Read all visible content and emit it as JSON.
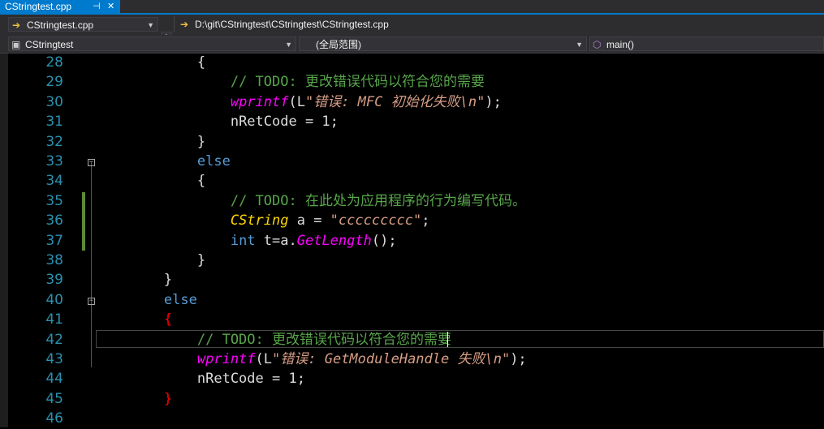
{
  "tab": {
    "title": "CStringtest.cpp",
    "pin_icon": "pin-icon",
    "close_icon": "close-icon"
  },
  "toolbar": {
    "file_combo": "CStringtest.cpp",
    "path": "D:\\git\\CStringtest\\CStringtest\\CStringtest.cpp",
    "project_combo": "CStringtest",
    "scope_combo": "(全局范围)",
    "member_combo": "main()"
  },
  "editor": {
    "lines": [
      {
        "num": "28",
        "indent": "            ",
        "tokens": [
          {
            "t": "{",
            "c": ""
          }
        ]
      },
      {
        "num": "29",
        "indent": "                ",
        "tokens": [
          {
            "t": "// TODO: 更改错误代码以符合您的需要",
            "c": "cmt"
          }
        ]
      },
      {
        "num": "30",
        "indent": "                ",
        "tokens": [
          {
            "t": "wprintf",
            "c": "fn"
          },
          {
            "t": "(L",
            "c": ""
          },
          {
            "t": "\"错误: MFC 初始化失败\\n\"",
            "c": "str"
          },
          {
            "t": ");",
            "c": ""
          }
        ]
      },
      {
        "num": "31",
        "indent": "                ",
        "tokens": [
          {
            "t": "nRetCode = 1;",
            "c": ""
          }
        ]
      },
      {
        "num": "32",
        "indent": "            ",
        "tokens": [
          {
            "t": "}",
            "c": ""
          }
        ]
      },
      {
        "num": "33",
        "indent": "            ",
        "tokens": [
          {
            "t": "else",
            "c": "kw"
          }
        ]
      },
      {
        "num": "34",
        "indent": "            ",
        "tokens": [
          {
            "t": "{",
            "c": ""
          }
        ]
      },
      {
        "num": "35",
        "indent": "                ",
        "tokens": [
          {
            "t": "// TODO: 在此处为应用程序的行为编写代码。",
            "c": "cmt"
          }
        ]
      },
      {
        "num": "36",
        "indent": "                ",
        "tokens": [
          {
            "t": "CString",
            "c": "ty"
          },
          {
            "t": " a = ",
            "c": ""
          },
          {
            "t": "\"ccccccccc\"",
            "c": "str"
          },
          {
            "t": ";",
            "c": ""
          }
        ]
      },
      {
        "num": "37",
        "indent": "                ",
        "tokens": [
          {
            "t": "int",
            "c": "kw"
          },
          {
            "t": " t=a.",
            "c": ""
          },
          {
            "t": "GetLength",
            "c": "fn"
          },
          {
            "t": "();",
            "c": ""
          }
        ]
      },
      {
        "num": "38",
        "indent": "            ",
        "tokens": [
          {
            "t": "}",
            "c": ""
          }
        ]
      },
      {
        "num": "39",
        "indent": "        ",
        "tokens": [
          {
            "t": "}",
            "c": ""
          }
        ]
      },
      {
        "num": "40",
        "indent": "        ",
        "tokens": [
          {
            "t": "else",
            "c": "kw"
          }
        ]
      },
      {
        "num": "41",
        "indent": "        ",
        "tokens": [
          {
            "t": "{",
            "c": "brace-red"
          }
        ]
      },
      {
        "num": "42",
        "indent": "            ",
        "tokens": [
          {
            "t": "// TODO: 更改错误代码以符合您的需要",
            "c": "cmt"
          }
        ]
      },
      {
        "num": "43",
        "indent": "            ",
        "tokens": [
          {
            "t": "wprintf",
            "c": "fn"
          },
          {
            "t": "(L",
            "c": ""
          },
          {
            "t": "\"错误: GetModuleHandle 失败\\n\"",
            "c": "str"
          },
          {
            "t": ");",
            "c": ""
          }
        ]
      },
      {
        "num": "44",
        "indent": "            ",
        "tokens": [
          {
            "t": "nRetCode = 1;",
            "c": ""
          }
        ]
      },
      {
        "num": "45",
        "indent": "        ",
        "tokens": [
          {
            "t": "}",
            "c": "brace-red"
          }
        ]
      },
      {
        "num": "46",
        "indent": "",
        "tokens": []
      }
    ]
  },
  "colors": {
    "accent": "#007acc",
    "comment": "#57a64a",
    "keyword": "#569cd6",
    "function": "#ff00ff",
    "type": "#ffd700",
    "string": "#d69d85",
    "line_number": "#2b91af"
  }
}
